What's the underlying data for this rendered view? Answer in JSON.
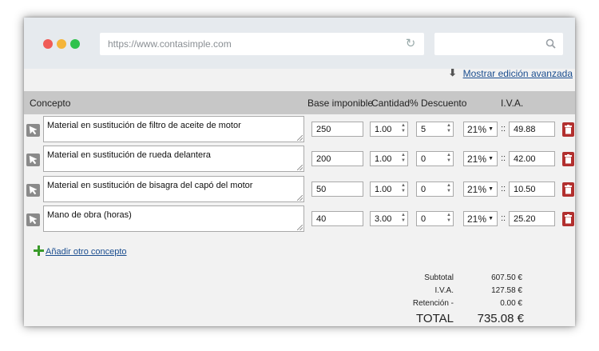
{
  "browser": {
    "url": "https://www.contasimple.com"
  },
  "advanced_link": "Mostrar edición avanzada",
  "columns": {
    "concepto": "Concepto",
    "base": "Base imponible",
    "cantidad": "Cantidad",
    "descuento": "% Descuento",
    "iva": "I.V.A."
  },
  "rows": [
    {
      "concepto": "Material en sustitución de filtro de aceite de motor",
      "base": "250",
      "cantidad": "1.00",
      "descuento": "5",
      "iva_rate": "21%",
      "iva_amount": "49.88"
    },
    {
      "concepto": "Material en sustitución de rueda delantera",
      "base": "200",
      "cantidad": "1.00",
      "descuento": "0",
      "iva_rate": "21%",
      "iva_amount": "42.00"
    },
    {
      "concepto": "Material en sustitución de bisagra del capó del motor",
      "base": "50",
      "cantidad": "1.00",
      "descuento": "0",
      "iva_rate": "21%",
      "iva_amount": "10.50"
    },
    {
      "concepto": "Mano de obra (horas)",
      "base": "40",
      "cantidad": "3.00",
      "descuento": "0",
      "iva_rate": "21%",
      "iva_amount": "25.20"
    }
  ],
  "add_concept": "Añadir otro concepto",
  "totals": {
    "subtotal_label": "Subtotal",
    "subtotal_value": "607.50 €",
    "iva_label": "I.V.A.",
    "iva_value": "127.58 €",
    "retencion_label": "Retención -",
    "retencion_value": "0.00 €",
    "total_label": "TOTAL",
    "total_value": "735.08 €"
  },
  "colors": {
    "header_bg": "#c7c7c7",
    "link": "#1a4d8f",
    "trash": "#b2302f",
    "add_icon": "#3a9a2a"
  }
}
